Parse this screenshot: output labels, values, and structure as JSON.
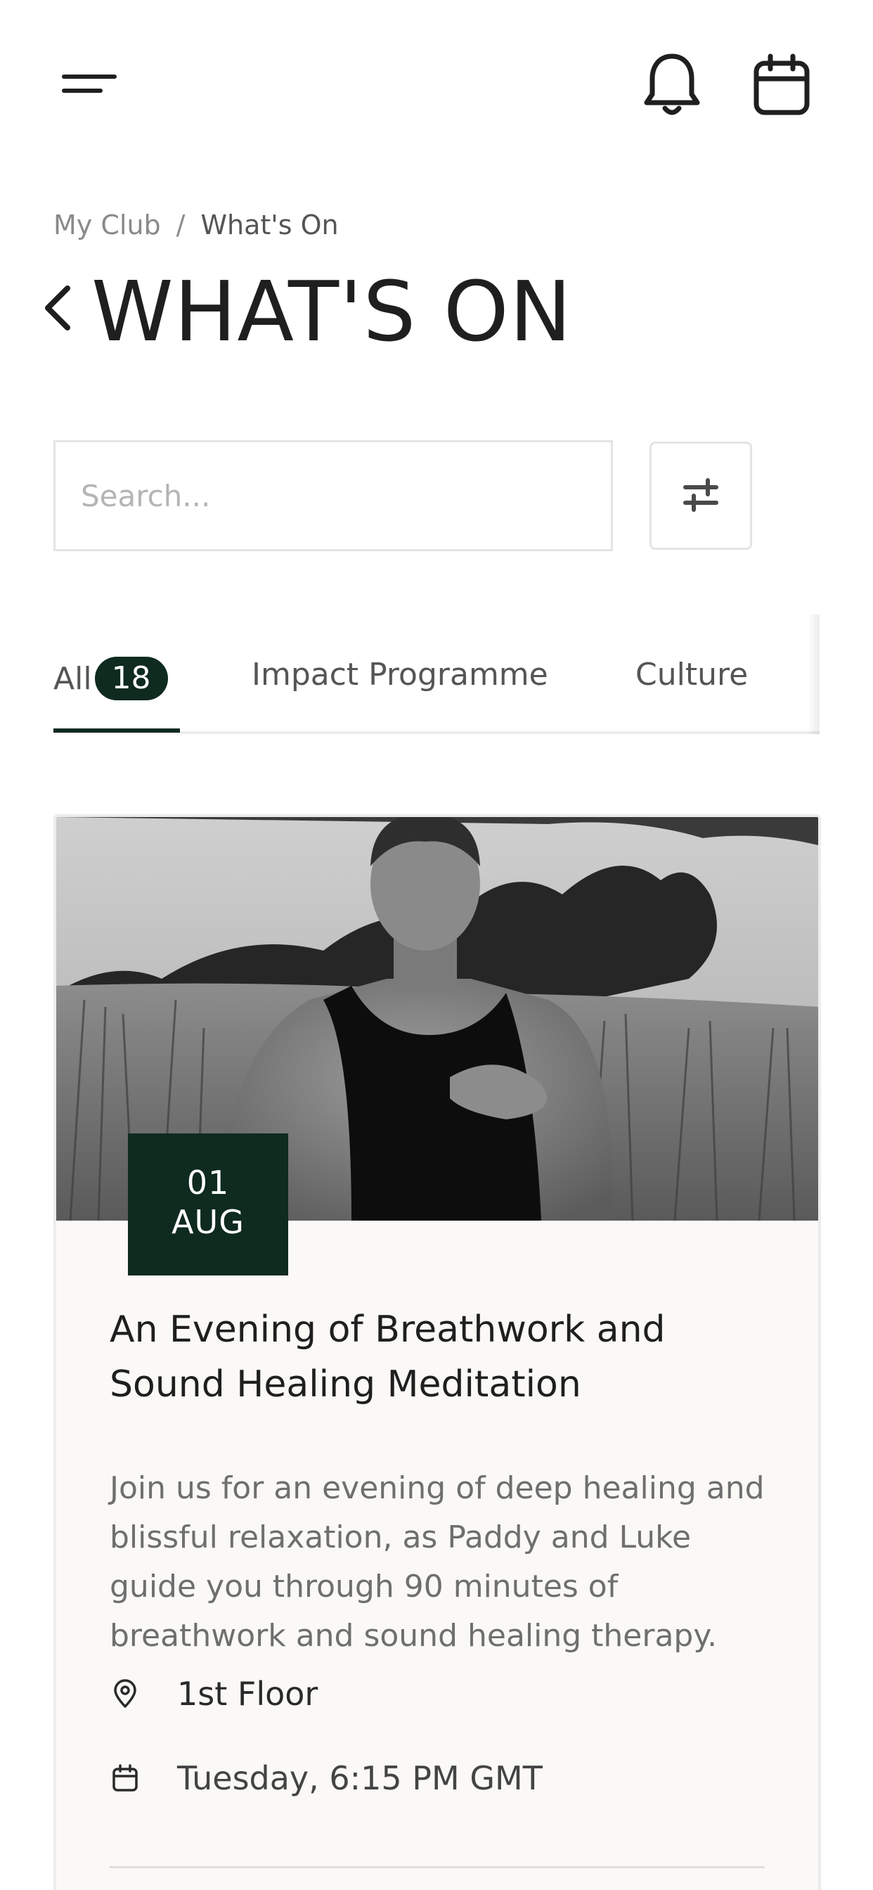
{
  "header": {
    "menu_icon": "menu-icon",
    "notification_icon": "bell-icon",
    "calendar_icon": "calendar-icon"
  },
  "breadcrumb": {
    "items": [
      "My Club",
      "What's On"
    ],
    "separator": "/"
  },
  "page": {
    "title": "WHAT'S ON",
    "back_icon": "chevron-left-icon"
  },
  "search": {
    "placeholder": "Search...",
    "value": ""
  },
  "filter": {
    "icon": "sliders-icon"
  },
  "tabs": [
    {
      "label": "All",
      "count": "18",
      "active": true
    },
    {
      "label": "Impact Programme",
      "active": false
    },
    {
      "label": "Culture",
      "active": false
    }
  ],
  "event": {
    "date_day": "01",
    "date_month": "AUG",
    "title": "An Evening of Breathwork and Sound Healing Meditation",
    "description": "Join us for an evening of deep healing and blissful relaxation, as Paddy and Luke guide you through 90 minutes of breathwork and sound healing therapy.",
    "location": "1st Floor",
    "time": "Tuesday, 6:15 PM GMT",
    "location_icon": "map-pin-icon",
    "time_icon": "calendar-icon"
  },
  "colors": {
    "brand_dark": "#0f2a1f",
    "text": "#1f1f1f",
    "muted": "#8a8a8a",
    "card_bg": "#faf9f6"
  }
}
